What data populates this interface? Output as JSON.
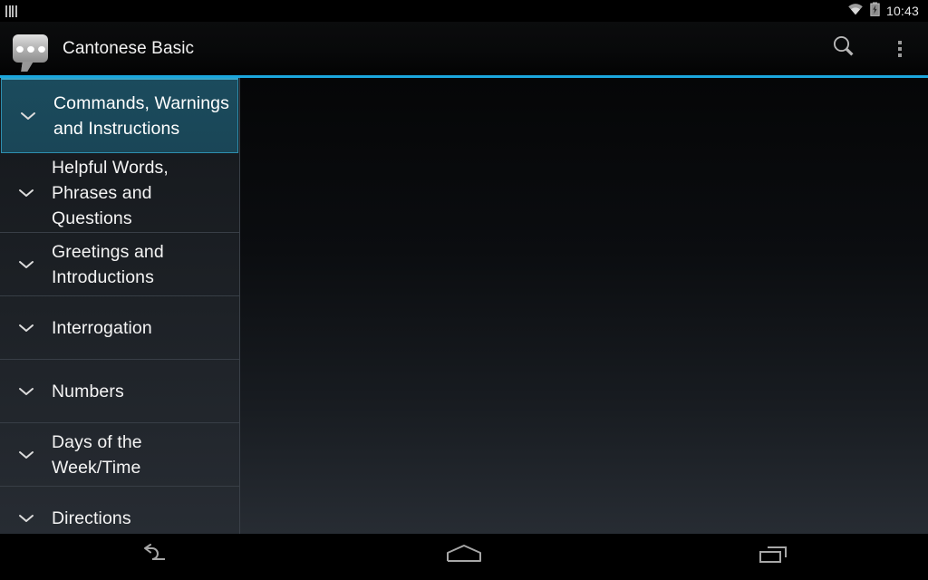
{
  "status_bar": {
    "notification_icon": "notification-bars-icon",
    "wifi_icon": "wifi-icon",
    "battery_icon": "battery-charging-icon",
    "time": "10:43"
  },
  "action_bar": {
    "app_icon": "speech-bubble-icon",
    "title": "Cantonese Basic",
    "search_icon": "search-icon",
    "overflow_icon": "overflow-menu-icon"
  },
  "accent_color": "#1ba6dd",
  "sidebar": {
    "items": [
      {
        "label": "Commands, Warnings and Instructions",
        "expander": "chevron-down-icon",
        "selected": true
      },
      {
        "label": "Helpful Words, Phrases and Questions",
        "expander": "chevron-down-icon",
        "selected": false
      },
      {
        "label": "Greetings and Introductions",
        "expander": "chevron-down-icon",
        "selected": false
      },
      {
        "label": "Interrogation",
        "expander": "chevron-down-icon",
        "selected": false
      },
      {
        "label": "Numbers",
        "expander": "chevron-down-icon",
        "selected": false
      },
      {
        "label": "Days of the Week/Time",
        "expander": "chevron-down-icon",
        "selected": false
      },
      {
        "label": "Directions",
        "expander": "chevron-down-icon",
        "selected": false
      }
    ]
  },
  "main_panel": {
    "content": ""
  },
  "nav_bar": {
    "back_icon": "back-arrow-icon",
    "home_icon": "home-icon",
    "recents_icon": "recent-apps-icon"
  }
}
